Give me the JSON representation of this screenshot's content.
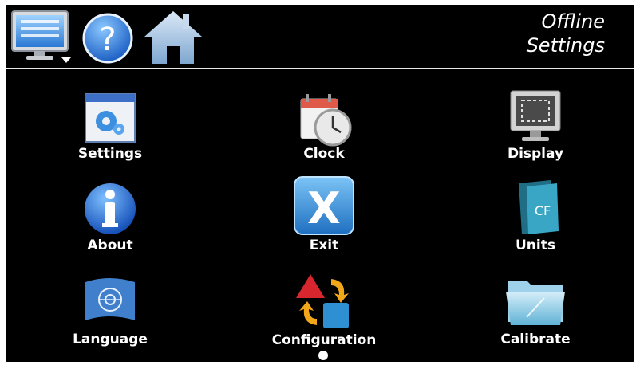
{
  "header": {
    "status_line1": "Offline",
    "status_line2": "Settings",
    "toolbar_icons": [
      "monitor-menu-icon",
      "help-icon",
      "home-icon"
    ]
  },
  "menu": {
    "items": [
      {
        "label": "Settings",
        "icon": "settings-icon"
      },
      {
        "label": "Clock",
        "icon": "clock-icon"
      },
      {
        "label": "Display",
        "icon": "display-icon"
      },
      {
        "label": "About",
        "icon": "about-icon"
      },
      {
        "label": "Exit",
        "icon": "exit-icon"
      },
      {
        "label": "Units",
        "icon": "units-icon"
      },
      {
        "label": "Language",
        "icon": "language-icon"
      },
      {
        "label": "Configuration",
        "icon": "configuration-icon"
      },
      {
        "label": "Calibrate",
        "icon": "calibrate-icon"
      }
    ],
    "units_badge": "CF",
    "exit_badge": "X"
  },
  "colors": {
    "background": "#000000",
    "text": "#ffffff",
    "accent_blue": "#3a8fd9",
    "divider": "#e8e8e8"
  }
}
